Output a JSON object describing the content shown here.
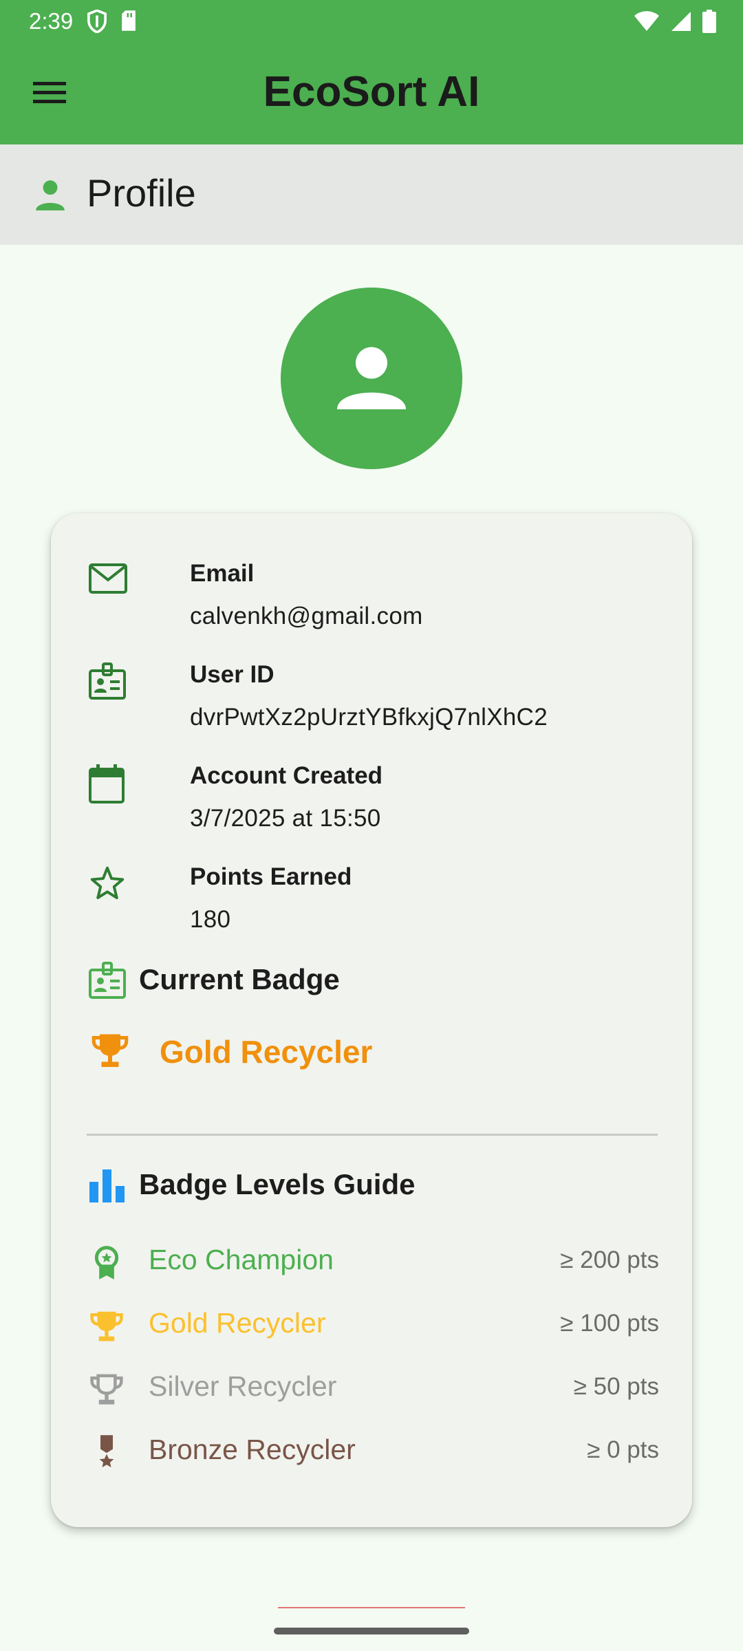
{
  "status_bar": {
    "time": "2:39",
    "icons": [
      "shield-icon",
      "sd-card-icon",
      "wifi-icon",
      "cell-signal-icon",
      "battery-icon"
    ]
  },
  "app_bar": {
    "title": "EcoSort AI",
    "menu_icon": "menu-icon",
    "background": "#4caf50"
  },
  "section": {
    "title": "Profile",
    "icon": "person-icon"
  },
  "profile": {
    "avatar_icon": "person-icon",
    "fields": [
      {
        "label": "Email",
        "value": "calvenkh@gmail.com",
        "icon": "mail-icon"
      },
      {
        "label": "User ID",
        "value": "dvrPwtXz2pUrztYBfkxjQ7nlXhC2",
        "icon": "id-badge-icon"
      },
      {
        "label": "Account Created",
        "value": "3/7/2025 at 15:50",
        "icon": "calendar-icon"
      },
      {
        "label": "Points Earned",
        "value": "180",
        "icon": "star-outline-icon"
      }
    ],
    "current_badge": {
      "heading": "Current Badge",
      "name": "Gold Recycler",
      "color": "#f0900c",
      "icon": "trophy-icon"
    }
  },
  "badge_guide": {
    "heading": "Badge Levels Guide",
    "icon": "bar-chart-icon",
    "levels": [
      {
        "name": "Eco Champion",
        "points": "≥ 200 pts",
        "color": "#4caf50",
        "icon": "award-ribbon-icon"
      },
      {
        "name": "Gold Recycler",
        "points": "≥ 100 pts",
        "color": "#fbc02d",
        "icon": "trophy-icon"
      },
      {
        "name": "Silver Recycler",
        "points": "≥ 50 pts",
        "color": "#9e9e9e",
        "icon": "trophy-outline-icon"
      },
      {
        "name": "Bronze Recycler",
        "points": "≥ 0 pts",
        "color": "#795548",
        "icon": "military-medal-icon"
      }
    ]
  }
}
